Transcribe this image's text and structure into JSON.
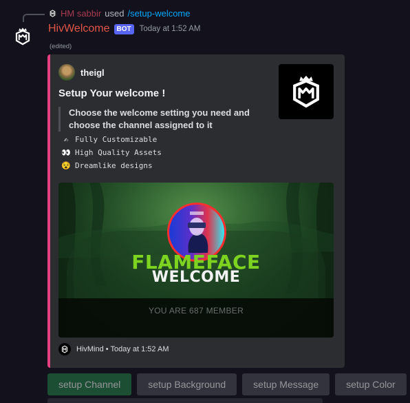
{
  "reply": {
    "user": "HM sabbir",
    "used": "used",
    "command": "/setup-welcome"
  },
  "message": {
    "bot_name": "HivWelcome",
    "badge": "BOT",
    "timestamp": "Today at 1:52 AM",
    "edited": "(edited)"
  },
  "embed": {
    "accent_color": "#e63f81",
    "author": "theigl",
    "title": "Setup Your welcome !",
    "description": "Choose the welcome setting you need and choose the channel assigned to it",
    "features": [
      {
        "icon": "writing-hand-icon",
        "glyph": "✍",
        "text": "Fully Customizable"
      },
      {
        "icon": "eyes-icon",
        "glyph": "👀",
        "text": "High Quality Assets"
      },
      {
        "icon": "dizzy-face-icon",
        "glyph": "😵",
        "text": "Dreamlike designs"
      }
    ],
    "image": {
      "brand": "FLAMEFACE",
      "heading": "WELCOME",
      "member_text": "YOU ARE 687 MEMBER"
    },
    "footer": {
      "text": "HivMind • Today at 1:52 AM"
    }
  },
  "buttons": [
    {
      "label": "setup Channel",
      "style": "primary"
    },
    {
      "label": "setup Background",
      "style": "secondary"
    },
    {
      "label": "setup Message",
      "style": "secondary"
    },
    {
      "label": "setup Color",
      "style": "secondary"
    }
  ]
}
